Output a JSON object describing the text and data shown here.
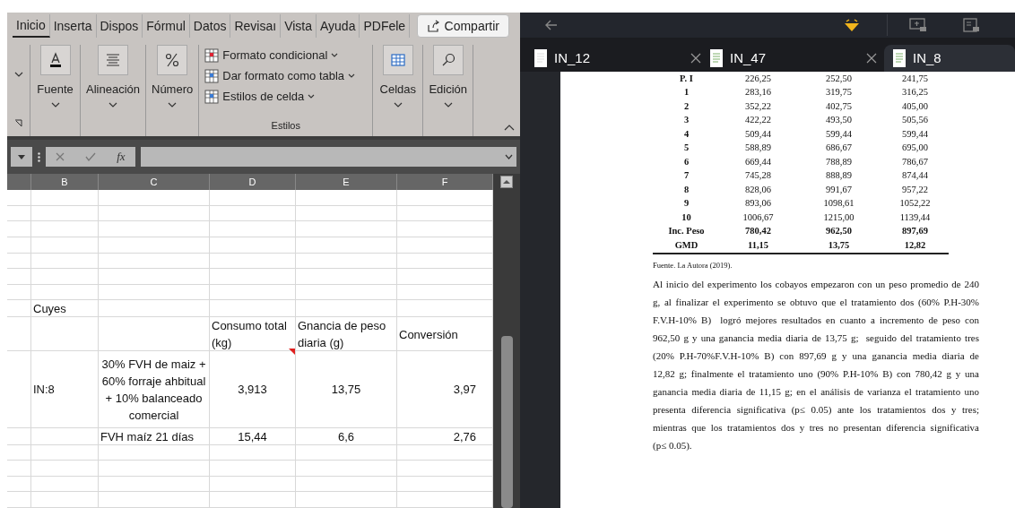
{
  "spreadsheet": {
    "ribbon_tabs": [
      {
        "label": "Inicio",
        "selected": true
      },
      {
        "label": "Inserta",
        "selected": false
      },
      {
        "label": "Dispos",
        "selected": false
      },
      {
        "label": "Fórmul",
        "selected": false
      },
      {
        "label": "Datos",
        "selected": false
      },
      {
        "label": "Revisaı",
        "selected": false
      },
      {
        "label": "Vista",
        "selected": false
      },
      {
        "label": "Ayuda",
        "selected": false
      },
      {
        "label": "PDFele",
        "selected": false
      }
    ],
    "share_button": "Compartir",
    "ribbon_groups": [
      {
        "kind": "big",
        "label": "Fuente"
      },
      {
        "kind": "big",
        "label": "Alineación"
      },
      {
        "kind": "big",
        "label": "Número"
      },
      {
        "kind": "styles",
        "label": "Estilos",
        "items": [
          "Formato condicional",
          "Dar formato como tabla",
          "Estilos de celda"
        ]
      },
      {
        "kind": "big",
        "label": "Celdas"
      },
      {
        "kind": "big",
        "label": "Edición"
      }
    ],
    "formula_bar": {
      "function_label": "fx"
    },
    "columns": [
      "B",
      "C",
      "D",
      "E",
      "F"
    ],
    "rows": [
      {
        "cells": [
          {
            "text": "Cuyes"
          },
          {
            "text": ""
          },
          {
            "text": ""
          },
          {
            "text": ""
          },
          {
            "text": ""
          }
        ],
        "kind": "short"
      },
      {
        "cells": [
          {
            "text": ""
          },
          {
            "text": ""
          },
          {
            "text": "Consumo total (kg)",
            "has_comment": true
          },
          {
            "text": "Gnancia de peso diaria (g)"
          },
          {
            "text": "Conversión"
          }
        ],
        "kind": "header"
      },
      {
        "cells": [
          {
            "text": "IN:8"
          },
          {
            "text": "30% FVH de maiz + 60% forraje ahbitual + 10% balanceado comercial"
          },
          {
            "text": "3,913"
          },
          {
            "text": "13,75"
          },
          {
            "text": "3,97"
          }
        ],
        "kind": "tall"
      },
      {
        "cells": [
          {
            "text": ""
          },
          {
            "text": "FVH maíz 21 días"
          },
          {
            "text": "15,44"
          },
          {
            "text": "6,6"
          },
          {
            "text": "2,76"
          }
        ],
        "kind": "short"
      }
    ]
  },
  "viewer": {
    "tabs": [
      {
        "label": "IN_12",
        "selected": false
      },
      {
        "label": "IN_47",
        "selected": false
      },
      {
        "label": "IN_8",
        "selected": true
      }
    ],
    "table_rows": [
      {
        "label": "P. I",
        "values": [
          "226,25",
          "252,50",
          "241,75"
        ],
        "bold": false
      },
      {
        "label": "1",
        "values": [
          "283,16",
          "319,75",
          "316,25"
        ],
        "bold": false
      },
      {
        "label": "2",
        "values": [
          "352,22",
          "402,75",
          "405,00"
        ],
        "bold": false
      },
      {
        "label": "3",
        "values": [
          "422,22",
          "493,50",
          "505,56"
        ],
        "bold": false
      },
      {
        "label": "4",
        "values": [
          "509,44",
          "599,44",
          "599,44"
        ],
        "bold": false
      },
      {
        "label": "5",
        "values": [
          "588,89",
          "686,67",
          "695,00"
        ],
        "bold": false
      },
      {
        "label": "6",
        "values": [
          "669,44",
          "788,89",
          "786,67"
        ],
        "bold": false
      },
      {
        "label": "7",
        "values": [
          "745,28",
          "888,89",
          "874,44"
        ],
        "bold": false
      },
      {
        "label": "8",
        "values": [
          "828,06",
          "991,67",
          "957,22"
        ],
        "bold": false
      },
      {
        "label": "9",
        "values": [
          "893,06",
          "1098,61",
          "1052,22"
        ],
        "bold": false
      },
      {
        "label": "10",
        "values": [
          "1006,67",
          "1215,00",
          "1139,44"
        ],
        "bold": false
      },
      {
        "label": "Inc. Peso",
        "values": [
          "780,42",
          "962,50",
          "897,69"
        ],
        "bold": true
      },
      {
        "label": "GMD",
        "values": [
          "11,15",
          "13,75",
          "12,82"
        ],
        "bold": true
      }
    ],
    "source": "Fuente. La Autora (2019).",
    "paragraph_lines": [
      "Al inicio del experimento los cobayos empezaron con un peso promedio de 240",
      "g, al finalizar el experimento se obtuvo que el tratamiento dos (60% P.H-30%",
      "F.V.H-10% B)  logró mejores resultados en cuanto a incremento de peso con",
      "962,50 g y una ganancia media diaria de 13,75 g;  seguido del tratamiento tres",
      "(20% P.H-70%F.V.H-10% B) con 897,69 g y una ganancia media diaria de",
      "12,82 g; finalmente el tratamiento uno (90% P.H-10% B) con 780,42 g y una",
      "ganancia media diaria de 11,15 g; en el análisis de varianza el tratamiento uno",
      "presenta diferencia significativa (p≤ 0.05) ante los tratamientos dos y tres;",
      "mientras que los tratamientos dos y tres no presentan diferencia significativa",
      "(p≤ 0.05)."
    ]
  }
}
